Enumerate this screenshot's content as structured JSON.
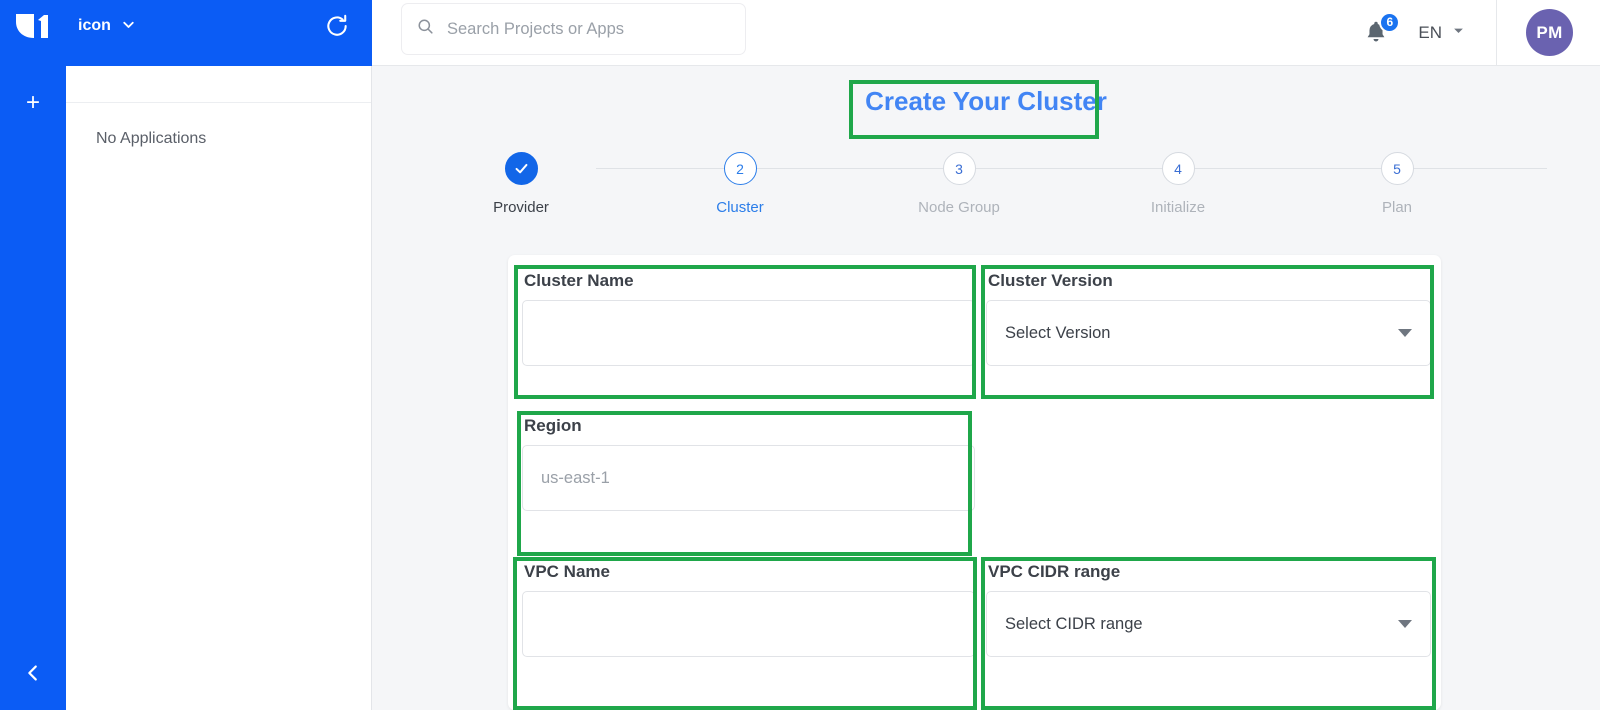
{
  "rail": {
    "logo_icon": "company-logo",
    "add_label": "+",
    "collapse_label": "‹"
  },
  "project_switcher": {
    "label": "icon",
    "caret_icon": "chevron-down-icon",
    "refresh_icon": "refresh-icon"
  },
  "apps_panel": {
    "empty_text": "No Applications"
  },
  "header": {
    "search": {
      "placeholder": "Search Projects or Apps",
      "icon": "search-icon"
    },
    "notifications": {
      "icon": "bell-icon",
      "count": "6"
    },
    "language": {
      "value": "EN",
      "caret_icon": "chevron-down-icon"
    },
    "avatar": {
      "initials": "PM"
    }
  },
  "main": {
    "title": "Create Your Cluster",
    "steps": [
      {
        "number": "1",
        "label": "Provider",
        "state": "done",
        "icon": "check-icon"
      },
      {
        "number": "2",
        "label": "Cluster",
        "state": "active"
      },
      {
        "number": "3",
        "label": "Node Group",
        "state": "todo"
      },
      {
        "number": "4",
        "label": "Initialize",
        "state": "todo"
      },
      {
        "number": "5",
        "label": "Plan",
        "state": "todo"
      }
    ],
    "fields": {
      "cluster_name": {
        "label": "Cluster Name",
        "value": "",
        "placeholder": ""
      },
      "cluster_version": {
        "label": "Cluster Version",
        "value": "Select Version",
        "caret_icon": "chevron-down-icon"
      },
      "region": {
        "label": "Region",
        "value": "",
        "placeholder": "us-east-1"
      },
      "vpc_name": {
        "label": "VPC Name",
        "value": "",
        "placeholder": ""
      },
      "vpc_cidr_range": {
        "label": "VPC CIDR range",
        "value": "Select CIDR range",
        "caret_icon": "chevron-down-icon"
      }
    }
  },
  "colors": {
    "brand_blue": "#0b5cf5",
    "title_blue": "#4285f4",
    "highlight_green": "#1fa74a",
    "avatar_purple": "#6a62b0",
    "page_bg": "#f5f6f8"
  }
}
